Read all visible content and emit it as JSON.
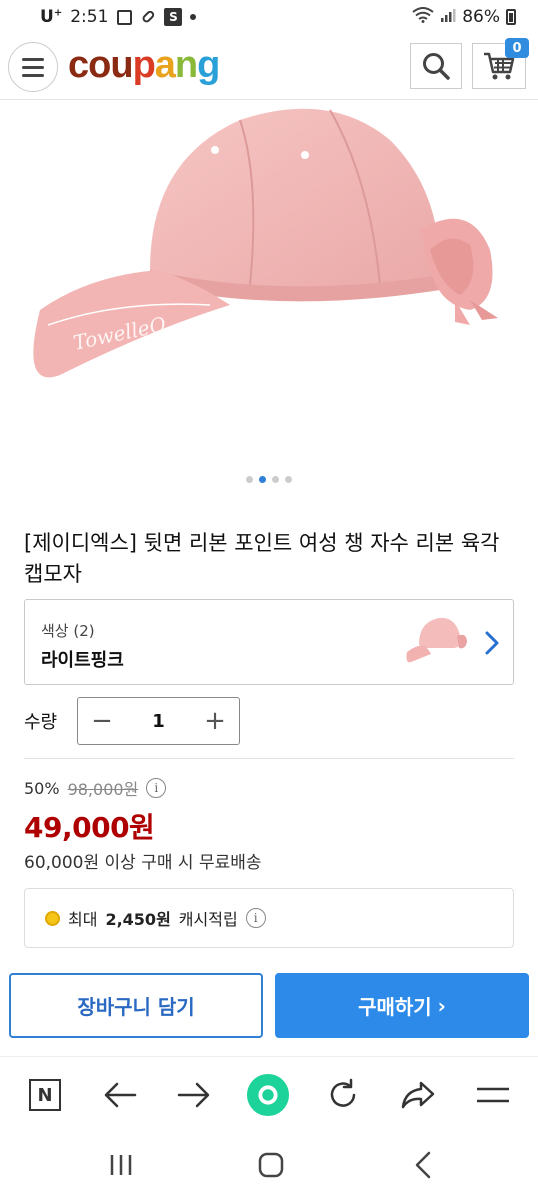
{
  "status_bar": {
    "carrier": "U",
    "carrier_sup": "+",
    "time": "2:51",
    "battery": "86%"
  },
  "header": {
    "logo": {
      "c1": "cou",
      "c2": "p",
      "c3": "a",
      "c4": "n",
      "c5": "g"
    },
    "cart_count": "0"
  },
  "product": {
    "title": "[제이디엑스] 뒷면 리본 포인트 여성 챙 자수 리본 육각캡모자",
    "carousel": {
      "total": 4,
      "active_index": 1
    }
  },
  "option": {
    "label": "색상 (2)",
    "value": "라이트핑크"
  },
  "quantity": {
    "label": "수량",
    "minus": "−",
    "value": "1",
    "plus": "+"
  },
  "price": {
    "discount": "50%",
    "original": "98,000원",
    "info": "i",
    "sale": "49,000원",
    "shipping": "60,000원 이상 구매 시 무료배송"
  },
  "cash": {
    "prefix": "최대",
    "amount": "2,450원",
    "suffix": "캐시적립",
    "info": "i"
  },
  "actions": {
    "add_to_cart": "장바구니 담기",
    "buy": "구매하기",
    "buy_arrow": "›"
  },
  "browser_bar": {
    "n_label": "N"
  },
  "colors": {
    "accent_blue": "#2d8ae8",
    "sale_red": "#ae0000",
    "cap_pink": "#f2b8b8"
  }
}
